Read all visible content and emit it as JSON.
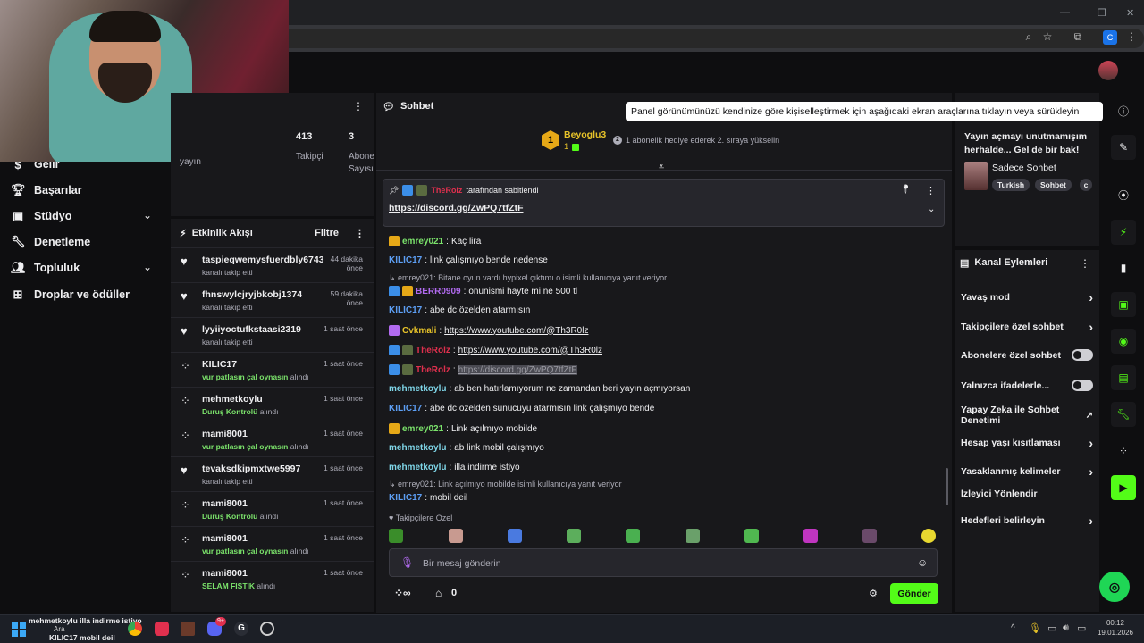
{
  "webcam": {
    "label": ""
  },
  "browser": {
    "window_controls": [
      "—",
      "❐",
      "✕"
    ]
  },
  "left_nav": {
    "items": [
      {
        "label": "Gelir",
        "icon": "dollar-icon"
      },
      {
        "label": "Başarılar",
        "icon": "trophy-icon"
      },
      {
        "label": "Stüdyo",
        "icon": "studio-icon"
      },
      {
        "label": "Denetleme",
        "icon": "wrench-icon"
      },
      {
        "label": "Topluluk",
        "icon": "community-icon"
      },
      {
        "label": "Droplar ve ödüller",
        "icon": "drops-icon"
      }
    ]
  },
  "stats": {
    "partial_label_left": "yayın",
    "followers_value": "413",
    "followers_label": "Takipçi",
    "subs_value": "3",
    "subs_label_1": "Abone",
    "subs_label_2": "Sayısı"
  },
  "feed": {
    "title": "Etkinlik Akışı",
    "filter": "Filtre",
    "items": [
      {
        "icon": "heart",
        "name": "taspieqwemysfuerdbly6743",
        "time": "44 dakika önce",
        "sub": "kanalı takip etti",
        "reward": ""
      },
      {
        "icon": "heart",
        "name": "fhnswylcjryjbkobj1374",
        "time": "59 dakika önce",
        "sub": "kanalı takip etti",
        "reward": ""
      },
      {
        "icon": "heart",
        "name": "lyyiiyoctufkstaasi2319",
        "time": "1 saat önce",
        "sub": "kanalı takip etti",
        "reward": ""
      },
      {
        "icon": "points",
        "name": "KILIC17",
        "time": "1 saat önce",
        "sub": "alındı",
        "reward": "vur patlasın çal oynasın"
      },
      {
        "icon": "points",
        "name": "mehmetkoylu",
        "time": "1 saat önce",
        "sub": "alındı",
        "reward": "Duruş Kontrolü"
      },
      {
        "icon": "points",
        "name": "mami8001",
        "time": "1 saat önce",
        "sub": "alındı",
        "reward": "vur patlasın çal oynasın"
      },
      {
        "icon": "heart",
        "name": "tevaksdkipmxtwe5997",
        "time": "1 saat önce",
        "sub": "kanalı takip etti",
        "reward": ""
      },
      {
        "icon": "points",
        "name": "mami8001",
        "time": "1 saat önce",
        "sub": "alındı",
        "reward": "Duruş Kontrolü"
      },
      {
        "icon": "points",
        "name": "mami8001",
        "time": "1 saat önce",
        "sub": "alındı",
        "reward": "vur patlasın çal oynasın"
      },
      {
        "icon": "points",
        "name": "mami8001",
        "time": "1 saat önce",
        "sub": "alındı",
        "reward": "SELAM FISTIK"
      }
    ]
  },
  "chat": {
    "title": "Sohbet",
    "leader_rank": "1",
    "leader_name": "Beyoglu3",
    "leader_count": "1",
    "gift_rank": "2",
    "gift_text": "1 abonelik hediye ederek 2. sıraya yükselin",
    "pinned_by_user": "TheRolz",
    "pinned_by_text": "tarafından sabitlendi",
    "pinned_link": "https://discord.gg/ZwPQ7tfZtF",
    "messages": [
      {
        "user": "emrey021",
        "color": "#7be36b",
        "text": "Kaç lira",
        "link": false
      },
      {
        "user": "KILIC17",
        "color": "#5d9ff5",
        "text": "link çalışmıyo bende nedense",
        "link": false
      },
      {
        "user": "BERR0909",
        "color": "#b26bf0",
        "text": "onunismi hayte mi ne 500 tl",
        "link": false
      },
      {
        "user": "KILIC17",
        "color": "#5d9ff5",
        "text": "abe dc özelden atarmısın",
        "link": false
      },
      {
        "user": "Cvkmali",
        "color": "#e6c229",
        "text": "https://www.youtube.com/@Th3R0lz",
        "link": true
      },
      {
        "user": "TheRolz",
        "color": "#e0304e",
        "text": "https://www.youtube.com/@Th3R0lz",
        "link": true
      },
      {
        "user": "TheRolz",
        "color": "#e0304e",
        "text": "https://discord.gg/ZwPQ7tfZtF",
        "link": true
      },
      {
        "user": "mehmetkoylu",
        "color": "#7fd6e8",
        "text": "ab ben hatırlamıyorum ne zamandan beri yayın açmıyorsan",
        "link": false
      },
      {
        "user": "KILIC17",
        "color": "#5d9ff5",
        "text": "abe dc özelden sunucuyu atarmısın link çalışmıyo bende",
        "link": false
      },
      {
        "user": "emrey021",
        "color": "#7be36b",
        "text": "Link açılmıyo mobilde",
        "link": false
      },
      {
        "user": "mehmetkoylu",
        "color": "#7fd6e8",
        "text": "ab link mobil çalışmıyo",
        "link": false
      },
      {
        "user": "mehmetkoylu",
        "color": "#7fd6e8",
        "text": "illa indirme istiyo",
        "link": false
      },
      {
        "user": "KILIC17",
        "color": "#5d9ff5",
        "text": "mobil deil",
        "link": false
      }
    ],
    "reply_1": "emrey021: Bitane oyun vardı hypixel çıktımı o isimli kullanıcıya yanıt veriyor",
    "reply_2": "emrey021: Link açılmıyo mobilde isimli kullanıcıya yanıt veriyor",
    "emote_label": "Takipçilere Özel",
    "input_placeholder": "Bir mesaj gönderin",
    "points_value": "0",
    "send_label": "Gönder"
  },
  "tooltip": "Panel görünümünüzü kendinize göre kişiselleştirmek için aşağıdaki ekran araçlarına tıklayın veya sürükleyin",
  "promo": {
    "text_1": "Yayın açmayı unutmamışım",
    "text_2": "herhalde... Gel de bir bak!",
    "channel": "Sadece Sohbet",
    "tags": [
      "Turkish",
      "Sohbet",
      "c"
    ]
  },
  "actions": {
    "title": "Kanal Eylemleri",
    "items": [
      {
        "label": "Yavaş mod",
        "control": "chevron"
      },
      {
        "label": "Takipçilere özel sohbet",
        "control": "chevron"
      },
      {
        "label": "Abonelere özel sohbet",
        "control": "toggle"
      },
      {
        "label": "Yalnızca ifadelerle...",
        "control": "toggle"
      },
      {
        "label": "Yapay Zeka ile Sohbet Denetimi",
        "control": "external"
      },
      {
        "label": "Hesap yaşı kısıtlaması",
        "control": "chevron"
      },
      {
        "label": "Yasaklanmış kelimeler",
        "control": "chevron"
      },
      {
        "label": "İzleyici Yönlendir",
        "control": "none"
      },
      {
        "label": "Hedefleri belirleyin",
        "control": "chevron"
      }
    ]
  },
  "taskbar": {
    "notif_user_1": "mehmetkoylu",
    "notif_text_1": "illa indirme istiyo",
    "notif_user_2": "KILIC17",
    "notif_text_2": "mobil deil",
    "search": "Ara",
    "time": "00:12",
    "date": "19.01.2026",
    "badge": "9+"
  },
  "colors": {
    "accent": "#53fc18",
    "bg": "#0e0e10",
    "panel": "#18181b"
  }
}
